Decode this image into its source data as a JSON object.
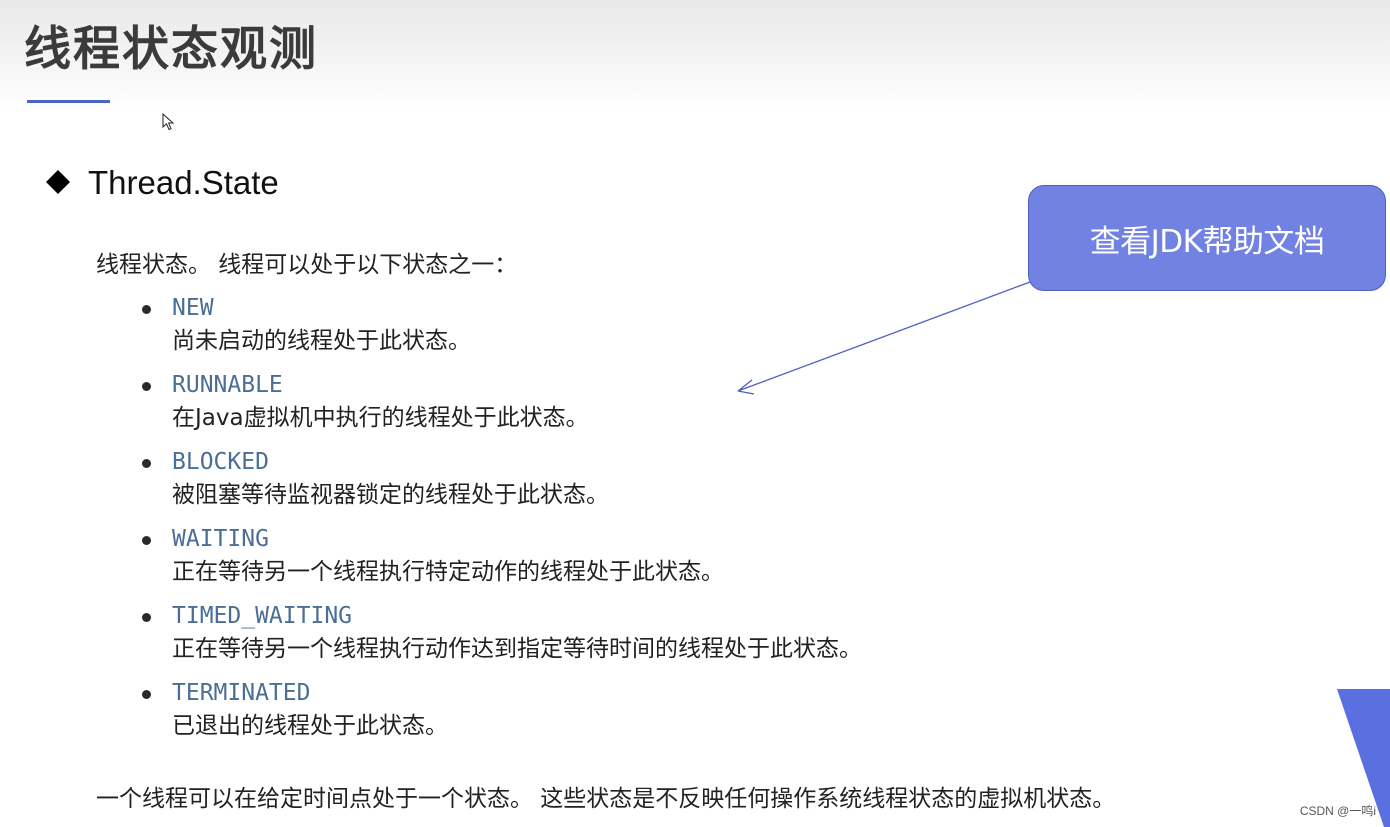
{
  "slide": {
    "title": "线程状态观测",
    "section_heading": "Thread.State",
    "intro": "线程状态。 线程可以处于以下状态之一：",
    "states": [
      {
        "name": "NEW",
        "description": "尚未启动的线程处于此状态。"
      },
      {
        "name": "RUNNABLE",
        "description": "在Java虚拟机中执行的线程处于此状态。"
      },
      {
        "name": "BLOCKED",
        "description": "被阻塞等待监视器锁定的线程处于此状态。"
      },
      {
        "name": "WAITING",
        "description": "正在等待另一个线程执行特定动作的线程处于此状态。"
      },
      {
        "name": "TIMED_WAITING",
        "description": "正在等待另一个线程执行动作达到指定等待时间的线程处于此状态。"
      },
      {
        "name": "TERMINATED",
        "description": "已退出的线程处于此状态。"
      }
    ],
    "footer": "一个线程可以在给定时间点处于一个状态。 这些状态是不反映任何操作系统线程状态的虚拟机状态。",
    "callout": "查看JDK帮助文档"
  },
  "watermark": "CSDN @一鸣i",
  "colors": {
    "title_underline": "#4a66c8",
    "callout_fill": "#7182e3",
    "state_name": "#4a6e96",
    "corner_accent": "#5a6fe0"
  },
  "icons": [
    "cursor-icon",
    "diamond-icon"
  ]
}
